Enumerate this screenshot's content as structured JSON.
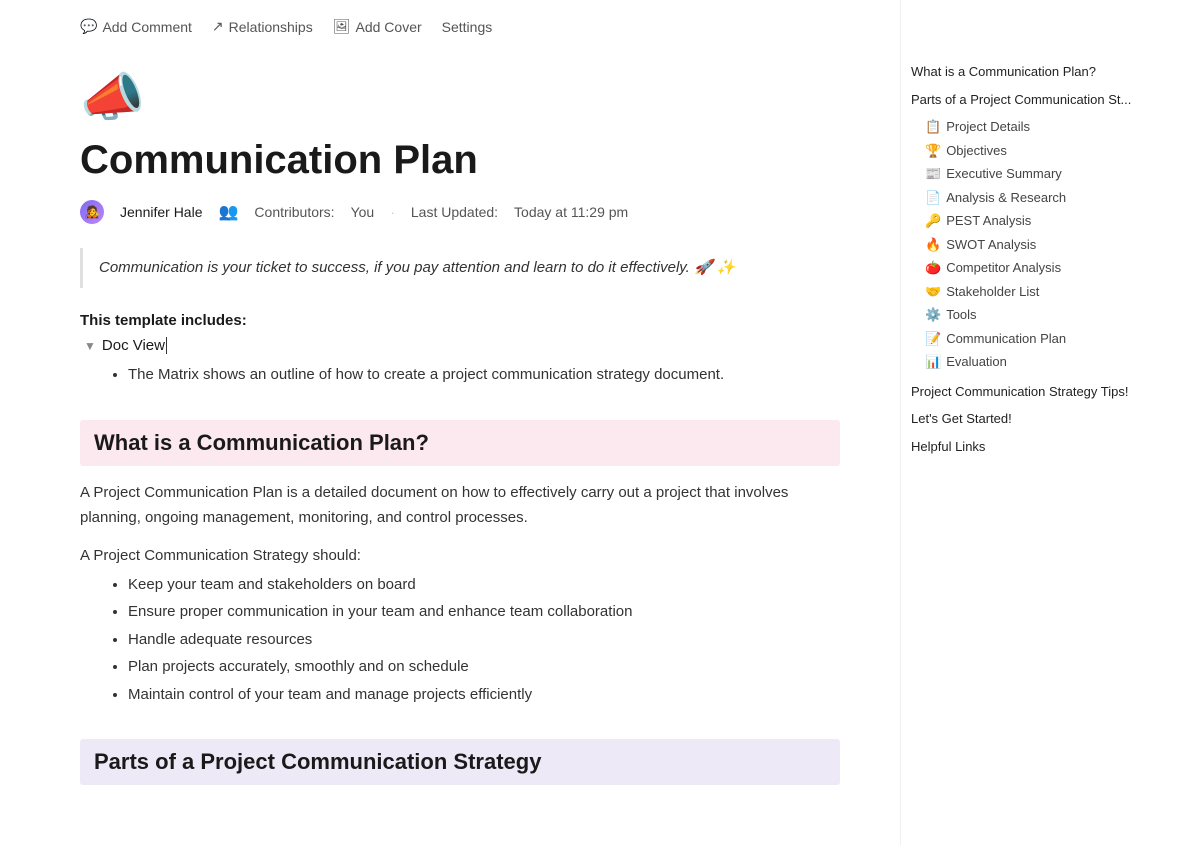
{
  "toolbar": {
    "add_comment": "Add Comment",
    "relationships": "Relationships",
    "add_cover": "Add Cover",
    "settings": "Settings"
  },
  "page": {
    "icon": "📣",
    "title": "Communication Plan",
    "author": {
      "name": "Jennifer Hale",
      "avatar_emoji": "🧑‍🎤"
    },
    "contributors_label": "Contributors:",
    "contributors_value": "You",
    "last_updated_label": "Last Updated:",
    "last_updated_value": "Today at 11:29 pm"
  },
  "blockquote": "Communication is your ticket to success, if you pay attention and learn to do it effectively. 🚀 ✨",
  "template": {
    "label": "This template includes:",
    "toggle_label": "Doc View",
    "bullet": "The Matrix shows an outline of how to create a project communication strategy document."
  },
  "section1": {
    "heading": "What is a Communication Plan?",
    "paragraph1": "A Project Communication Plan is a detailed document on how to effectively carry out a project that involves planning, ongoing management, monitoring, and control processes.",
    "sub_label": "A Project Communication Strategy should:",
    "bullets": [
      "Keep your team and stakeholders on board",
      "Ensure proper communication in your team and enhance team collaboration",
      "Handle adequate resources",
      "Plan projects accurately, smoothly and on schedule",
      "Maintain control of your team and manage projects efficiently"
    ]
  },
  "section2": {
    "heading": "Parts of a Project Communication Strategy"
  },
  "sidebar": {
    "items_top": [
      {
        "label": "What is a Communication Plan?",
        "indent": false,
        "emoji": ""
      },
      {
        "label": "Parts of a Project Communication St...",
        "indent": false,
        "emoji": ""
      }
    ],
    "subitems": [
      {
        "label": "Project Details",
        "emoji": "📋"
      },
      {
        "label": "Objectives",
        "emoji": "🏆"
      },
      {
        "label": "Executive Summary",
        "emoji": "📰"
      },
      {
        "label": "Analysis & Research",
        "emoji": "📄"
      },
      {
        "label": "PEST Analysis",
        "emoji": "🔑"
      },
      {
        "label": "SWOT Analysis",
        "emoji": "🔥"
      },
      {
        "label": "Competitor Analysis",
        "emoji": "🍅"
      },
      {
        "label": "Stakeholder List",
        "emoji": "🤝"
      },
      {
        "label": "Tools",
        "emoji": "⚙️"
      },
      {
        "label": "Communication Plan",
        "emoji": "📝"
      },
      {
        "label": "Evaluation",
        "emoji": "📊"
      }
    ],
    "items_bottom": [
      {
        "label": "Project Communication Strategy Tips!"
      },
      {
        "label": "Let's Get Started!"
      },
      {
        "label": "Helpful Links"
      }
    ]
  }
}
